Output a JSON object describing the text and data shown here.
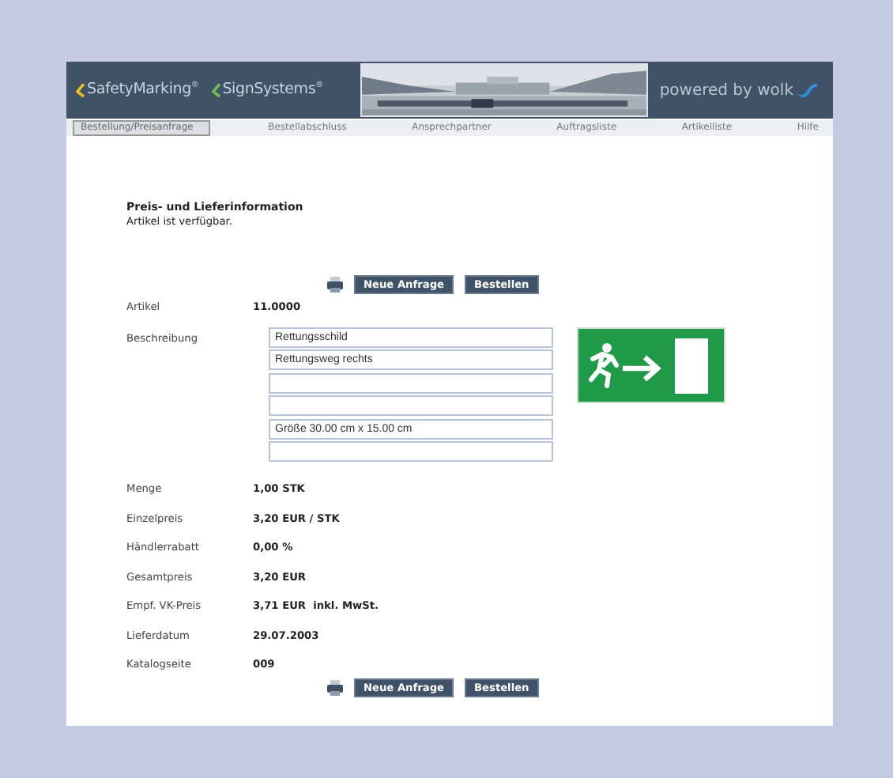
{
  "header": {
    "brands": [
      {
        "text": "SafetyMarking$^{®}$",
        "color": "#e8c020"
      },
      {
        "text": "SignSystems$^{®}$",
        "color": "#6cc04a"
      }
    ],
    "powered": "powered by wolk"
  },
  "tabs": [
    {
      "label": "Bestellung/Preisanfrage",
      "selected": true
    },
    {
      "label": "Bestellabschluss",
      "selected": false
    },
    {
      "label": "Ansprechpartner",
      "selected": false
    },
    {
      "label": "Auftragsliste",
      "selected": false
    },
    {
      "label": "Artikelliste",
      "selected": false
    },
    {
      "label": "Hilfe",
      "selected": false
    }
  ],
  "section": {
    "title": "Preis- und Lieferinformation",
    "status": "Artikel ist verfügbar."
  },
  "actions_top": [
    "Neue Anfrage",
    "Bestellen"
  ],
  "article": {
    "label": "Artikel",
    "value": "11.0000"
  },
  "description": {
    "label": "Beschreibung",
    "fields": [
      {
        "kind": "text",
        "value": "Rettungsschild"
      },
      {
        "kind": "text",
        "value": "Rettungsweg rechts"
      },
      {
        "kind": "blank"
      },
      {
        "kind": "blank"
      },
      {
        "kind": "text",
        "value": "Größe 30.00 cm x 15.00 cm"
      },
      {
        "kind": "blank"
      }
    ]
  },
  "details": [
    {
      "label": "Menge",
      "value": "1,00 STK"
    },
    {
      "label": "Einzelpreis",
      "value": "3,20 EUR / STK"
    },
    {
      "label": "Händlerrabatt",
      "value": "0,00 %"
    },
    {
      "label": "Gesamtpreis",
      "value": "3,20 EUR"
    },
    {
      "label": "Empf. VK-Preis",
      "value": "3,71 EUR  inkl. MwSt."
    },
    {
      "label": "Lieferdatum",
      "value": "29.07.2003"
    },
    {
      "label": "Katalogseite",
      "value": "009"
    }
  ],
  "actions_bottom": [
    "Neue Anfrage",
    "Bestellen"
  ]
}
